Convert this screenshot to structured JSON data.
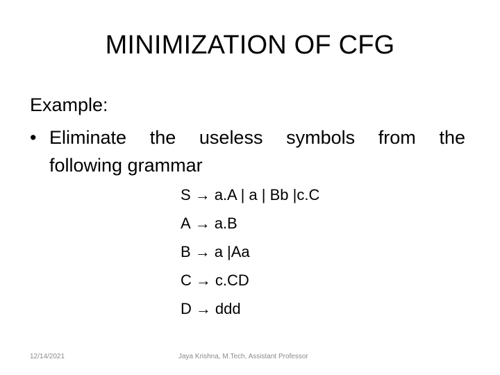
{
  "slide": {
    "title": "MINIMIZATION OF CFG",
    "heading": "Example:",
    "bullet": {
      "marker": "•",
      "line1_words": [
        "Eliminate",
        "the",
        "useless",
        "symbols",
        "from",
        "the"
      ],
      "line2": "following grammar"
    },
    "arrow_glyph": "→",
    "productions": [
      {
        "lhs": "S",
        "rhs": "a.A | a | Bb |c.C"
      },
      {
        "lhs": "A",
        "rhs": "a.B"
      },
      {
        "lhs": "B",
        "rhs": "a |Aa"
      },
      {
        "lhs": "C",
        "rhs": "c.CD"
      },
      {
        "lhs": "D",
        "rhs": "ddd"
      }
    ],
    "footer": {
      "date": "12/14/2021",
      "author": "Jaya Krishna, M.Tech, Assistant Professor"
    }
  }
}
